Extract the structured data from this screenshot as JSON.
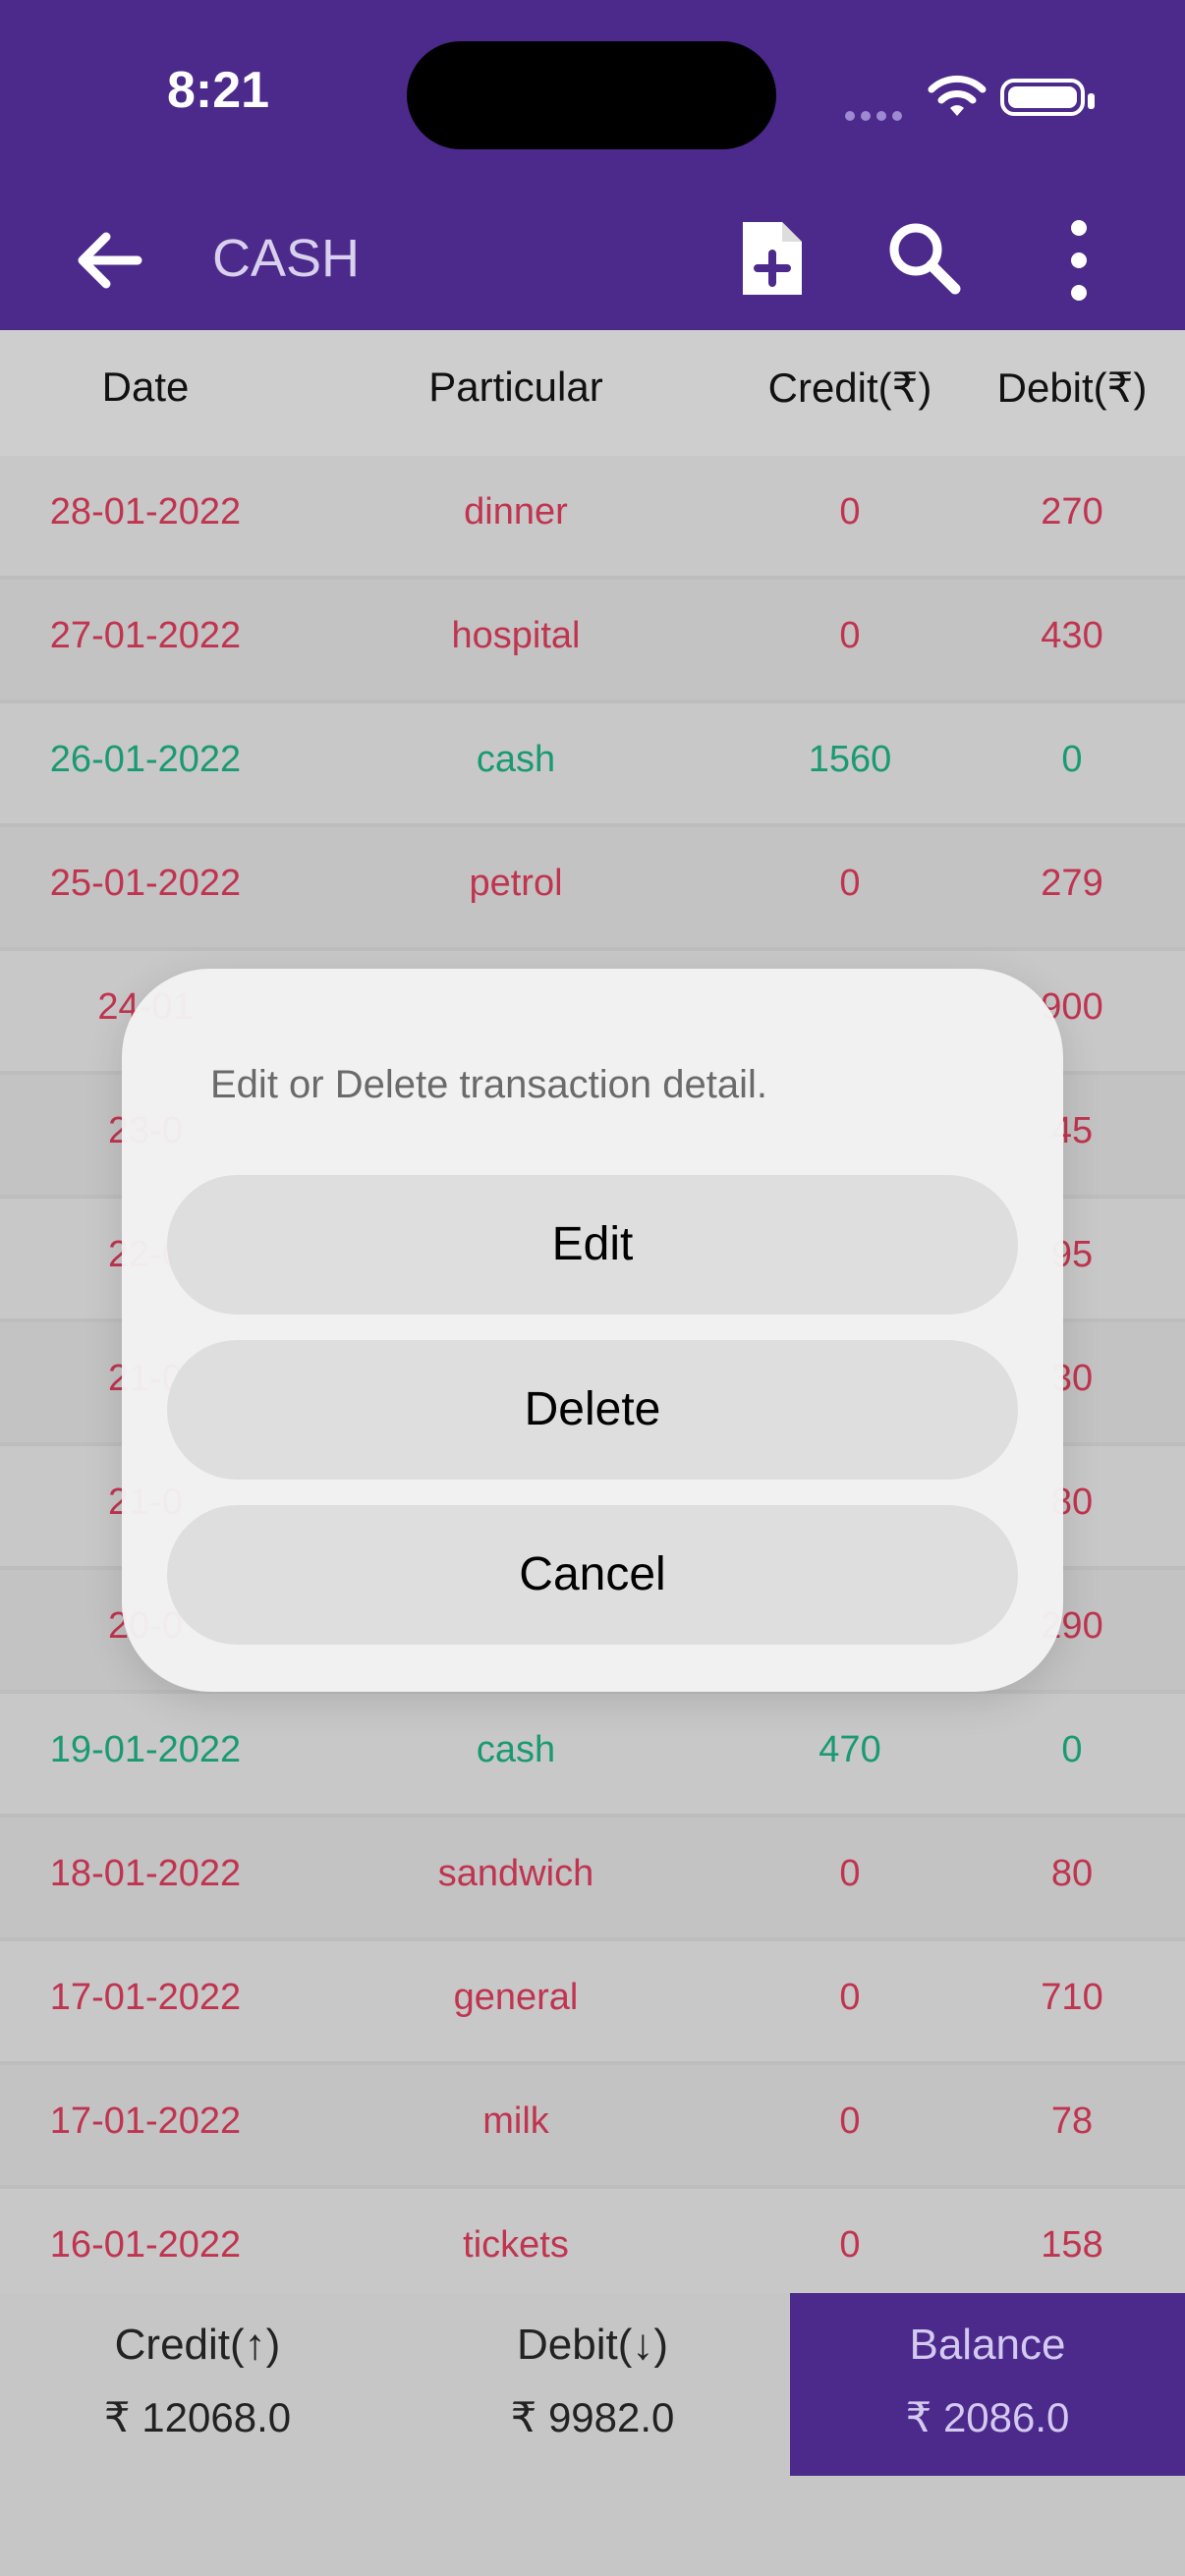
{
  "status_bar": {
    "time": "8:21"
  },
  "app_bar": {
    "title": "CASH",
    "icons": [
      "back-arrow-icon",
      "add-document-icon",
      "search-icon",
      "more-vertical-icon"
    ]
  },
  "table": {
    "headers": [
      "Date",
      "Particular",
      "Credit(₹)",
      "Debit(₹)"
    ],
    "rows": [
      {
        "date": "28-01-2022",
        "particular": "dinner",
        "credit": "0",
        "debit": "270",
        "type": "debit"
      },
      {
        "date": "27-01-2022",
        "particular": "hospital",
        "credit": "0",
        "debit": "430",
        "type": "debit"
      },
      {
        "date": "26-01-2022",
        "particular": "cash",
        "credit": "1560",
        "debit": "0",
        "type": "credit"
      },
      {
        "date": "25-01-2022",
        "particular": "petrol",
        "credit": "0",
        "debit": "279",
        "type": "debit"
      },
      {
        "date": "24-01",
        "particular": "",
        "credit": "",
        "debit": "900",
        "type": "debit"
      },
      {
        "date": "23-0",
        "particular": "",
        "credit": "",
        "debit": "45",
        "type": "debit"
      },
      {
        "date": "22-0",
        "particular": "",
        "credit": "",
        "debit": "95",
        "type": "debit"
      },
      {
        "date": "21-0",
        "particular": "",
        "credit": "",
        "debit": "30",
        "type": "debit"
      },
      {
        "date": "21-0",
        "particular": "",
        "credit": "",
        "debit": "80",
        "type": "debit"
      },
      {
        "date": "20-0",
        "particular": "",
        "credit": "",
        "debit": "290",
        "type": "debit"
      },
      {
        "date": "19-01-2022",
        "particular": "cash",
        "credit": "470",
        "debit": "0",
        "type": "credit"
      },
      {
        "date": "18-01-2022",
        "particular": "sandwich",
        "credit": "0",
        "debit": "80",
        "type": "debit"
      },
      {
        "date": "17-01-2022",
        "particular": "general",
        "credit": "0",
        "debit": "710",
        "type": "debit"
      },
      {
        "date": "17-01-2022",
        "particular": "milk",
        "credit": "0",
        "debit": "78",
        "type": "debit"
      },
      {
        "date": "16-01-2022",
        "particular": "tickets",
        "credit": "0",
        "debit": "158",
        "type": "debit"
      }
    ]
  },
  "footer": {
    "credit_label": "Credit(↑)",
    "credit_value": "₹ 12068.0",
    "debit_label": "Debit(↓)",
    "debit_value": "₹ 9982.0",
    "balance_label": "Balance",
    "balance_value": "₹ 2086.0"
  },
  "dialog": {
    "message": "Edit or Delete transaction detail.",
    "edit_label": "Edit",
    "delete_label": "Delete",
    "cancel_label": "Cancel"
  },
  "colors": {
    "primary": "#4b2a8c",
    "debit_text": "#c0344f",
    "credit_text": "#1a9a72"
  }
}
